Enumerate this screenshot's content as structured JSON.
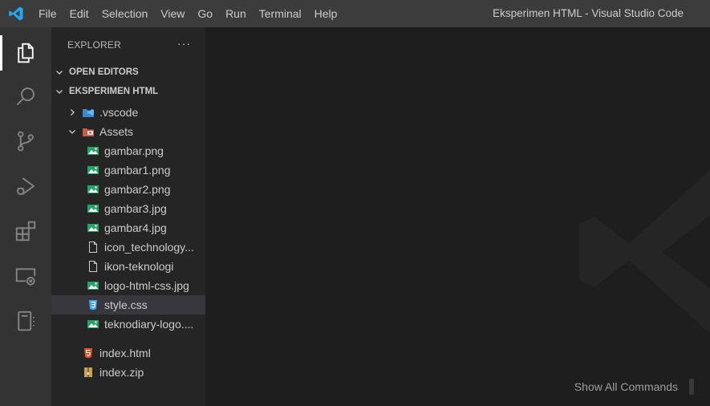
{
  "menu": [
    "File",
    "Edit",
    "Selection",
    "View",
    "Go",
    "Run",
    "Terminal",
    "Help"
  ],
  "window_title": "Eksperimen HTML - Visual Studio Code",
  "activity": [
    {
      "name": "explorer-icon"
    },
    {
      "name": "search-icon"
    },
    {
      "name": "source-control-icon"
    },
    {
      "name": "run-debug-icon"
    },
    {
      "name": "extensions-icon"
    },
    {
      "name": "remote-explorer-icon"
    },
    {
      "name": "notebook-icon"
    }
  ],
  "explorer": {
    "title": "EXPLORER",
    "more": "···",
    "open_editors": "OPEN EDITORS",
    "folder": "EKSPERIMEN HTML",
    "items": [
      {
        "label": ".vscode",
        "icon": "vscode-folder-icon",
        "depth": 1,
        "chevron": "right"
      },
      {
        "label": "Assets",
        "icon": "assets-folder-icon",
        "depth": 1,
        "chevron": "down"
      },
      {
        "label": "gambar.png",
        "icon": "image-file-icon",
        "depth": 2
      },
      {
        "label": "gambar1.png",
        "icon": "image-file-icon",
        "depth": 2
      },
      {
        "label": "gambar2.png",
        "icon": "image-file-icon",
        "depth": 2
      },
      {
        "label": "gambar3.jpg",
        "icon": "image-file-icon",
        "depth": 2
      },
      {
        "label": "gambar4.jpg",
        "icon": "image-file-icon",
        "depth": 2
      },
      {
        "label": "icon_technology...",
        "icon": "generic-file-icon",
        "depth": 2
      },
      {
        "label": "ikon-teknologi",
        "icon": "generic-file-icon",
        "depth": 2
      },
      {
        "label": "logo-html-css.jpg",
        "icon": "image-file-icon",
        "depth": 2
      },
      {
        "label": "style.css",
        "icon": "css-file-icon",
        "depth": 2,
        "selected": true
      },
      {
        "label": "teknodiary-logo....",
        "icon": "image-file-icon",
        "depth": 2
      },
      {
        "label": "index.html",
        "icon": "html-file-icon",
        "depth": 1
      },
      {
        "label": "index.zip",
        "icon": "zip-file-icon",
        "depth": 1
      }
    ]
  },
  "editor": {
    "hint_label": "Show All Commands"
  },
  "colors": {
    "accent": "#007acc",
    "image_icon": "#26a269",
    "css_icon": "#42a5f5",
    "html_icon": "#e44d26",
    "zip_icon": "#c9a15a"
  }
}
